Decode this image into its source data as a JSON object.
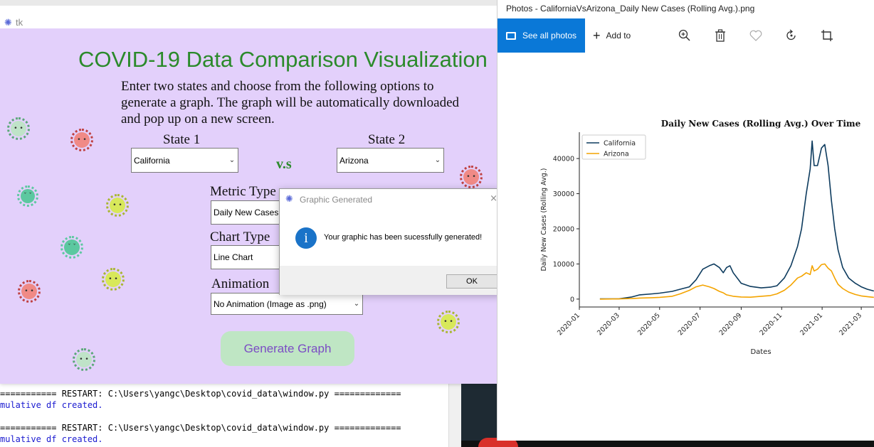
{
  "shell": {
    "lines": [
      {
        "text": "=========== RESTART: C:\\Users\\yangc\\Desktop\\covid_data\\window.py =============",
        "kind": "restart"
      },
      {
        "text": "mulative df created.",
        "kind": "out"
      },
      {
        "text": "",
        "kind": "out"
      },
      {
        "text": "=========== RESTART: C:\\Users\\yangc\\Desktop\\covid_data\\window.py =============",
        "kind": "restart"
      },
      {
        "text": "mulative df created.",
        "kind": "out"
      }
    ]
  },
  "tk": {
    "window_title": "tk",
    "heading": "COVID-19 Data Comparison Visualization",
    "instructions": "Enter two states and choose from the following options to generate a graph. The graph will be automatically downloaded and pop up on a new screen.",
    "state1_label": "State 1",
    "state2_label": "State 2",
    "vs_label": "v.s",
    "state1_value": "California",
    "state2_value": "Arizona",
    "metric_label": "Metric Type",
    "metric_value": "Daily New Cases (",
    "chart_type_label": "Chart Type",
    "chart_type_value": "Line Chart",
    "animation_label": "Animation",
    "animation_value": "No Animation (Image as .png)",
    "generate_label": "Generate Graph"
  },
  "dialog": {
    "title": "Graphic Generated",
    "message": "Your graphic has been sucessfully generated!",
    "ok_label": "OK",
    "close_glyph": "×"
  },
  "photos": {
    "window_title": "Photos - CaliforniaVsArizona_Daily New Cases (Rolling Avg.).png",
    "see_all_label": "See all photos",
    "add_to_label": "Add to",
    "icons": [
      "zoom-in-icon",
      "delete-icon",
      "favorite-icon",
      "rotate-icon",
      "crop-icon"
    ]
  },
  "chart_data": {
    "type": "line",
    "title": "Daily New Cases (Rolling Avg.) Over Time",
    "xlabel": "Dates",
    "ylabel": "Daily New Cases (Rolling Avg.)",
    "ylim": [
      0,
      45000
    ],
    "yticks": [
      0,
      10000,
      20000,
      30000,
      40000
    ],
    "xticks": [
      "2020-01",
      "2020-03",
      "2020-05",
      "2020-07",
      "2020-09",
      "2020-11",
      "2021-01",
      "2021-03"
    ],
    "legend": "upper-left",
    "grid": false,
    "x": [
      "2020-02-01",
      "2020-03-01",
      "2020-03-20",
      "2020-04-01",
      "2020-04-20",
      "2020-05-01",
      "2020-05-20",
      "2020-06-01",
      "2020-06-15",
      "2020-06-25",
      "2020-07-05",
      "2020-07-15",
      "2020-07-22",
      "2020-07-30",
      "2020-08-05",
      "2020-08-10",
      "2020-08-15",
      "2020-08-20",
      "2020-09-01",
      "2020-09-15",
      "2020-10-01",
      "2020-10-15",
      "2020-10-25",
      "2020-11-05",
      "2020-11-15",
      "2020-11-25",
      "2020-12-01",
      "2020-12-08",
      "2020-12-14",
      "2020-12-17",
      "2020-12-20",
      "2020-12-25",
      "2020-12-31",
      "2021-01-05",
      "2021-01-10",
      "2021-01-15",
      "2021-01-20",
      "2021-01-25",
      "2021-02-01",
      "2021-02-10",
      "2021-02-20",
      "2021-03-01",
      "2021-03-10",
      "2021-03-20"
    ],
    "series": [
      {
        "name": "California",
        "color": "#0d3b5e",
        "values": [
          50,
          100,
          600,
          1200,
          1500,
          1700,
          2200,
          2800,
          3500,
          5500,
          8500,
          9500,
          10000,
          9000,
          7500,
          9000,
          9500,
          7500,
          4500,
          3600,
          3200,
          3400,
          3800,
          6000,
          9500,
          15000,
          20000,
          30000,
          37000,
          45000,
          38000,
          38000,
          43000,
          44000,
          38000,
          28000,
          20000,
          14000,
          9000,
          6000,
          4500,
          3500,
          2800,
          2300
        ]
      },
      {
        "name": "Arizona",
        "color": "#f4a400",
        "values": [
          0,
          50,
          150,
          300,
          400,
          500,
          800,
          1500,
          2500,
          3500,
          4000,
          3500,
          3000,
          2200,
          1800,
          1200,
          1000,
          800,
          600,
          550,
          800,
          1000,
          1500,
          2500,
          4000,
          6000,
          6500,
          7500,
          7000,
          9500,
          8000,
          8500,
          9800,
          10000,
          8800,
          8000,
          6000,
          4200,
          3000,
          2000,
          1300,
          900,
          700,
          500
        ]
      }
    ]
  }
}
